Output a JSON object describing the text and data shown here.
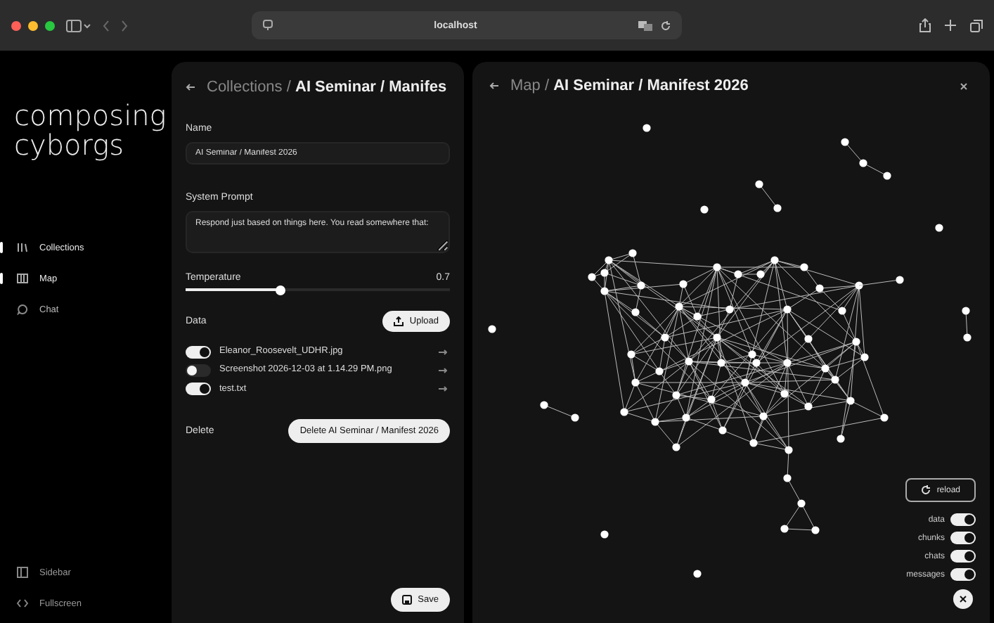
{
  "browser": {
    "url": "localhost"
  },
  "sidebar": {
    "logo_lines": [
      "composing",
      "cyborgs"
    ],
    "nav": [
      {
        "label": "Collections",
        "selected": true
      },
      {
        "label": "Map",
        "selected": true
      },
      {
        "label": "Chat",
        "selected": false
      }
    ],
    "footer": [
      {
        "label": "Sidebar"
      },
      {
        "label": "Fullscreen"
      }
    ]
  },
  "collection_panel": {
    "breadcrumb": {
      "parent": "Collections",
      "separator": "/",
      "current": "AI Seminar / Manifes"
    },
    "name": {
      "label": "Name",
      "value": "AI Seminar / Manifest 2026"
    },
    "system_prompt": {
      "label": "System Prompt",
      "value": "Respond just based on things here. You read somewhere that:"
    },
    "temperature": {
      "label": "Temperature",
      "level": 0.36,
      "reading": "0.7"
    },
    "data": {
      "label": "Data",
      "upload_button": "Upload",
      "files": [
        {
          "name": "Eleanor_Roosevelt_UDHR.jpg",
          "on": true
        },
        {
          "name": "Screenshot 2026-12-03 at 1.14.29 PM.png",
          "on": false
        },
        {
          "name": "test.txt",
          "on": true
        }
      ]
    },
    "delete": {
      "label": "Delete",
      "button": "Delete AI Seminar / Manifest 2026"
    },
    "save_button": "Save"
  },
  "map_panel": {
    "breadcrumb": {
      "parent": "Map",
      "separator": "/",
      "current": "AI Seminar / Manifest 2026"
    },
    "reload_button": "reload",
    "layers": [
      {
        "label": "data",
        "on": true
      },
      {
        "label": "chunks",
        "on": true
      },
      {
        "label": "chats",
        "on": true
      },
      {
        "label": "messages",
        "on": true
      }
    ]
  }
}
